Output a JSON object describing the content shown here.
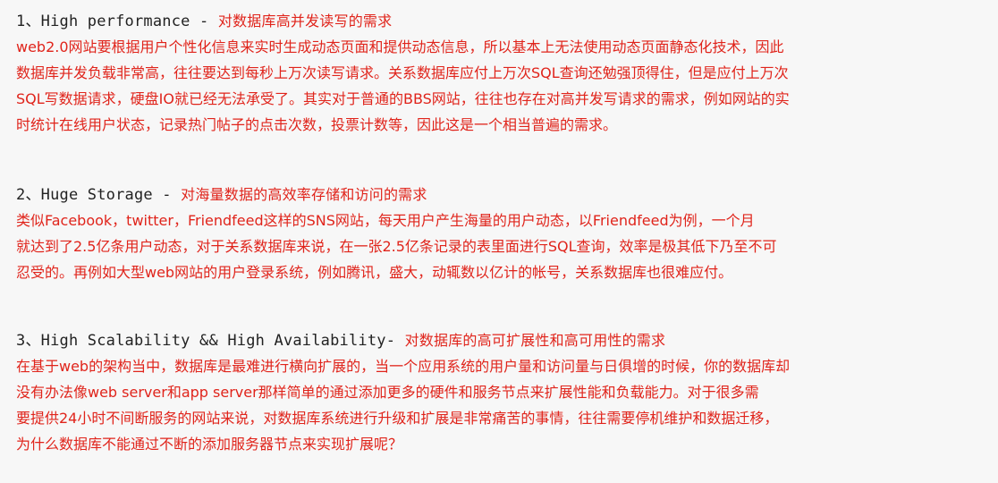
{
  "colors": {
    "background": "#f7f7f7",
    "heading_text": "#222222",
    "red_text": "#e0241b"
  },
  "sections": [
    {
      "title_en": "1、High performance - ",
      "title_zh": "对数据库高并发读写的需求",
      "lines": [
        "web2.0网站要根据用户个性化信息来实时生成动态页面和提供动态信息，所以基本上无法使用动态页面静态化技术，因此",
        "数据库并发负载非常高，往往要达到每秒上万次读写请求。关系数据库应付上万次SQL查询还勉强顶得住，但是应付上万次",
        "SQL写数据请求，硬盘IO就已经无法承受了。其实对于普通的BBS网站，往往也存在对高并发写请求的需求，例如网站的实",
        "时统计在线用户状态，记录热门帖子的点击次数，投票计数等，因此这是一个相当普遍的需求。"
      ]
    },
    {
      "title_en": "2、Huge Storage - ",
      "title_zh": "对海量数据的高效率存储和访问的需求",
      "lines": [
        "类似Facebook，twitter，Friendfeed这样的SNS网站，每天用户产生海量的用户动态，以Friendfeed为例，一个月",
        "就达到了2.5亿条用户动态，对于关系数据库来说，在一张2.5亿条记录的表里面进行SQL查询，效率是极其低下乃至不可",
        "忍受的。再例如大型web网站的用户登录系统，例如腾讯，盛大，动辄数以亿计的帐号，关系数据库也很难应付。"
      ]
    },
    {
      "title_en": "3、High Scalability && High Availability- ",
      "title_zh": "对数据库的高可扩展性和高可用性的需求",
      "lines": [
        "在基于web的架构当中，数据库是最难进行横向扩展的，当一个应用系统的用户量和访问量与日俱增的时候，你的数据库却",
        "没有办法像web server和app server那样简单的通过添加更多的硬件和服务节点来扩展性能和负载能力。对于很多需",
        "要提供24小时不间断服务的网站来说，对数据库系统进行升级和扩展是非常痛苦的事情，往往需要停机维护和数据迁移，",
        "为什么数据库不能通过不断的添加服务器节点来实现扩展呢？"
      ]
    }
  ]
}
